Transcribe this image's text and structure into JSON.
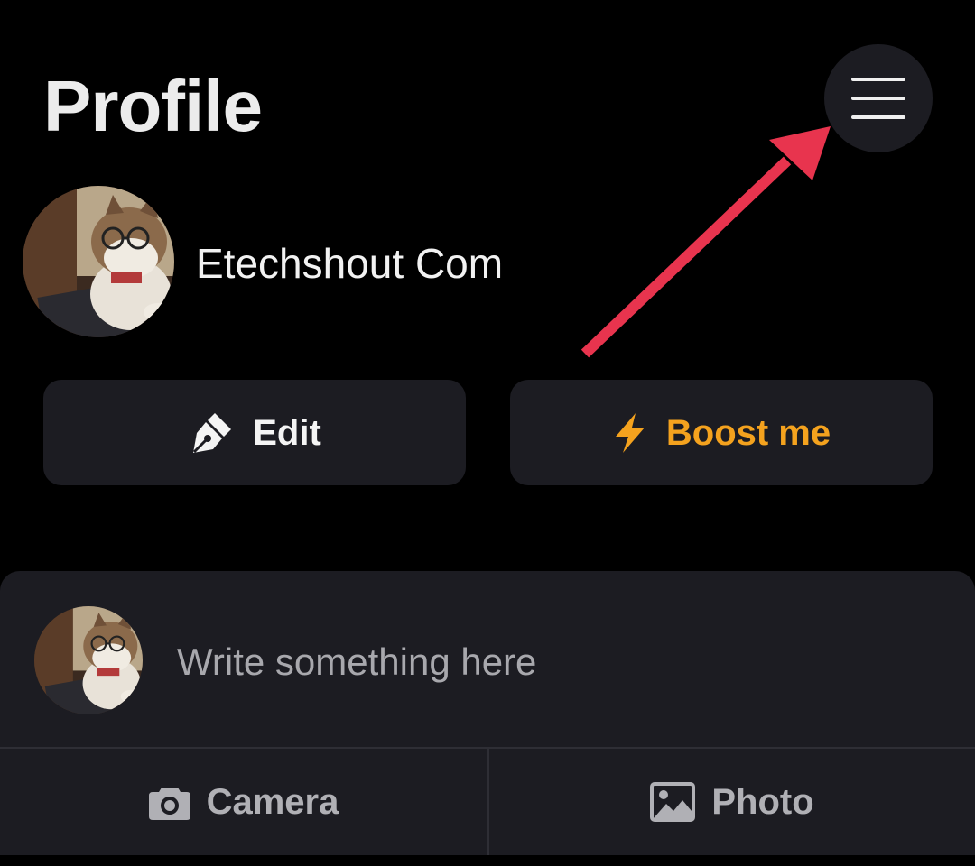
{
  "header": {
    "title": "Profile",
    "menu_icon": "hamburger-menu-icon"
  },
  "profile": {
    "name": "Etechshout Com",
    "avatar_icon": "cat-avatar"
  },
  "actions": {
    "edit_label": "Edit",
    "edit_icon": "pen-nib-icon",
    "boost_label": "Boost me",
    "boost_icon": "lightning-bolt-icon"
  },
  "composer": {
    "placeholder": "Write something here",
    "camera_label": "Camera",
    "camera_icon": "camera-icon",
    "photo_label": "Photo",
    "photo_icon": "image-icon"
  },
  "annotation": {
    "arrow_color": "#e8344e",
    "arrow_icon": "red-arrow-pointer"
  },
  "colors": {
    "background": "#000000",
    "surface": "#1c1c22",
    "accent": "#f4a21e",
    "muted_text": "#a8a8ad"
  }
}
